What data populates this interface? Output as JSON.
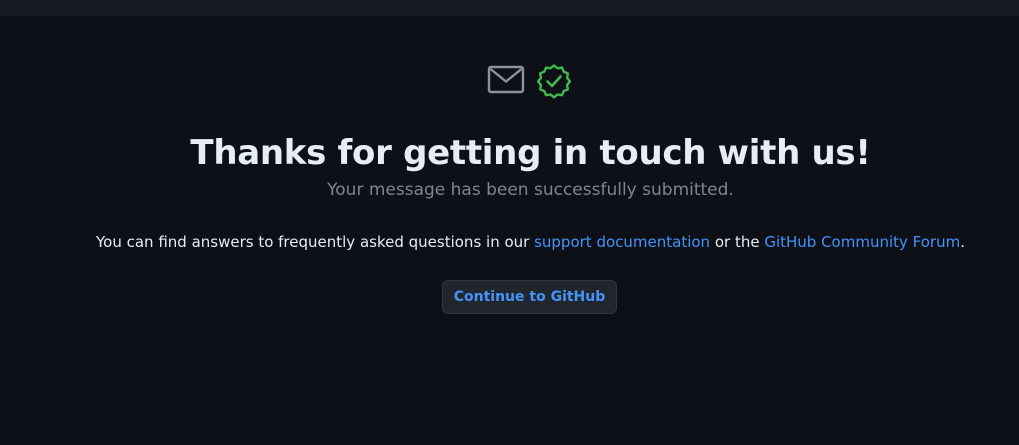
{
  "heading": {
    "title": "Thanks for getting in touch with us!",
    "subtitle": "Your message has been successfully submitted."
  },
  "info": {
    "prefix": "You can find answers to frequently asked questions in our ",
    "link1": "support documentation",
    "middle": " or the ",
    "link2": "GitHub Community Forum",
    "suffix": "."
  },
  "actions": {
    "continue_label": "Continue to GitHub"
  },
  "icons": [
    "mail-icon",
    "verified-check-icon"
  ],
  "colors": {
    "background": "#0d1117",
    "topbar": "#161b22",
    "heading": "#e6edf3",
    "muted": "#7d8590",
    "link": "#4493f8",
    "success": "#3fb950"
  }
}
